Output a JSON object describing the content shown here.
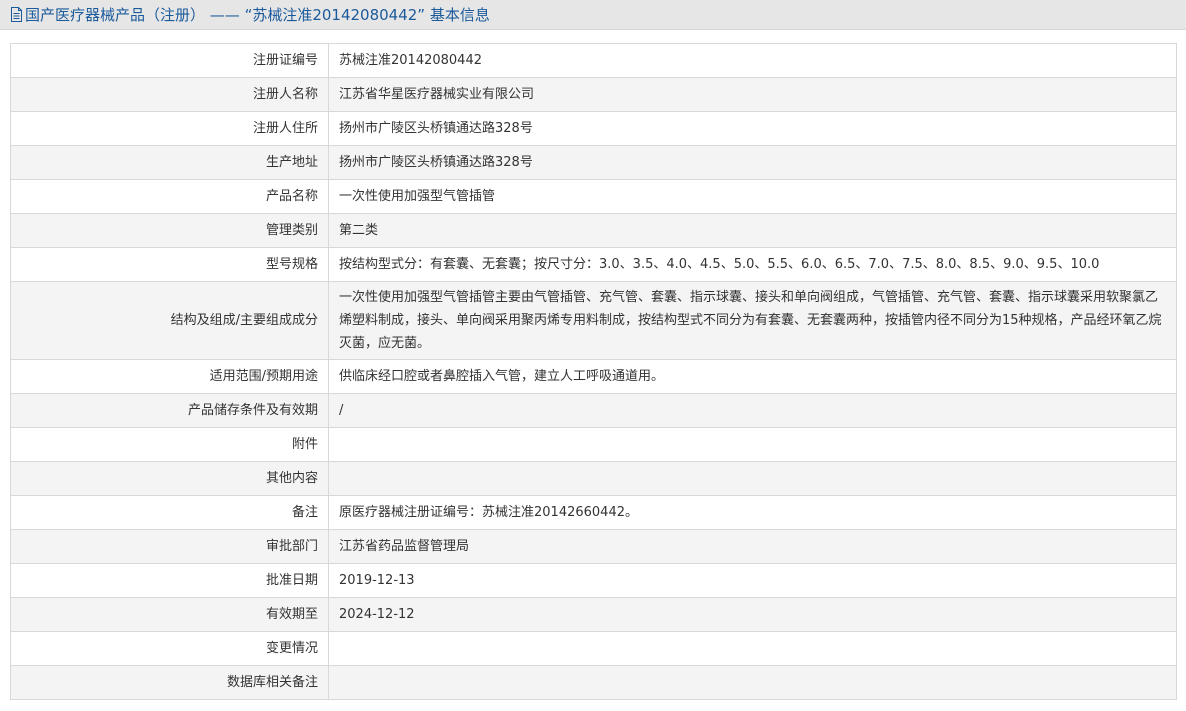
{
  "header": {
    "prefix": "国产医疗器械产品（注册）",
    "separator": " —— ",
    "reg_title": "“苏械注准20142080442” 基本信息"
  },
  "rows": [
    {
      "label": "注册证编号",
      "value": "苏械注准20142080442"
    },
    {
      "label": "注册人名称",
      "value": "江苏省华星医疗器械实业有限公司"
    },
    {
      "label": "注册人住所",
      "value": "扬州市广陵区头桥镇通达路328号"
    },
    {
      "label": "生产地址",
      "value": "扬州市广陵区头桥镇通达路328号"
    },
    {
      "label": "产品名称",
      "value": "一次性使用加强型气管插管"
    },
    {
      "label": "管理类别",
      "value": "第二类"
    },
    {
      "label": "型号规格",
      "value": "按结构型式分：有套囊、无套囊；按尺寸分：3.0、3.5、4.0、4.5、5.0、5.5、6.0、6.5、7.0、7.5、8.0、8.5、9.0、9.5、10.0"
    },
    {
      "label": "结构及组成/主要组成成分",
      "value": "一次性使用加强型气管插管主要由气管插管、充气管、套囊、指示球囊、接头和单向阀组成，气管插管、充气管、套囊、指示球囊采用软聚氯乙烯塑料制成，接头、单向阀采用聚丙烯专用料制成，按结构型式不同分为有套囊、无套囊两种，按插管内径不同分为15种规格，产品经环氧乙烷灭菌，应无菌。"
    },
    {
      "label": "适用范围/预期用途",
      "value": "供临床经口腔或者鼻腔插入气管，建立人工呼吸通道用。"
    },
    {
      "label": "产品储存条件及有效期",
      "value": "/"
    },
    {
      "label": "附件",
      "value": ""
    },
    {
      "label": "其他内容",
      "value": ""
    },
    {
      "label": "备注",
      "value": "原医疗器械注册证编号：苏械注准20142660442。"
    },
    {
      "label": "审批部门",
      "value": "江苏省药品监督管理局"
    },
    {
      "label": "批准日期",
      "value": "2019-12-13"
    },
    {
      "label": "有效期至",
      "value": "2024-12-12"
    },
    {
      "label": "变更情况",
      "value": ""
    },
    {
      "label": "数据库相关备注",
      "value": ""
    }
  ]
}
